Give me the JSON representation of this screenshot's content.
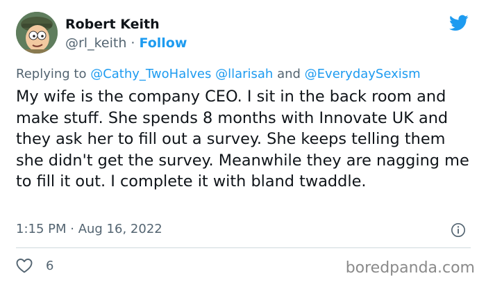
{
  "author": {
    "name": "Robert Keith",
    "handle": "@rl_keith",
    "separator": " · ",
    "follow_label": "Follow",
    "avatar": "cartoon-character-avatar"
  },
  "header_icon": "twitter-bird-icon",
  "reply_context": {
    "prefix": "Replying to ",
    "mentions": [
      "@Cathy_TwoHalves",
      "@llarisah",
      "@EverydaySexism"
    ],
    "joiner": "and"
  },
  "tweet": {
    "text": "My wife is the company CEO. I sit in the back room and make stuff. She spends 8 months with Innovate UK and they ask her to fill out a survey. She keeps telling them she didn't get the survey. Meanwhile they are nagging me to fill it out. I complete it with bland twaddle.",
    "timestamp": "1:15 PM · Aug 16, 2022"
  },
  "actions": {
    "like_icon": "heart-icon",
    "like_count": "6",
    "info_icon": "info-icon"
  },
  "watermark": "boredpanda.com",
  "colors": {
    "accent": "#1d9bf0",
    "secondary_text": "#536471",
    "primary_text": "#0f1419",
    "divider": "#cfd9de"
  }
}
